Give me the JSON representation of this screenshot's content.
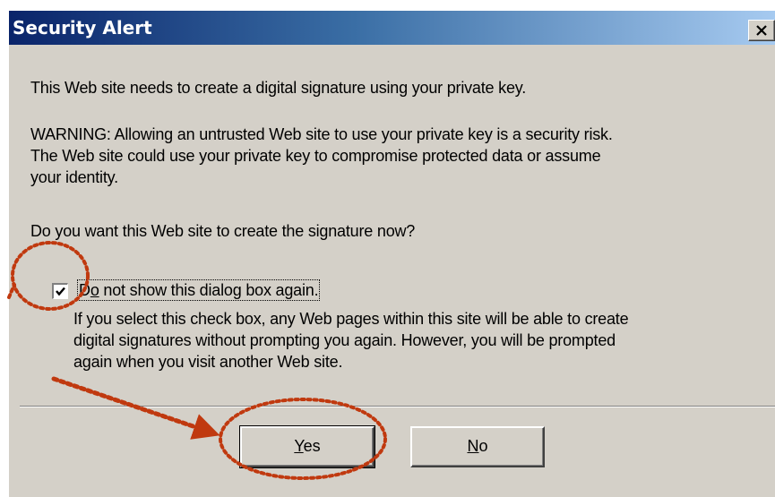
{
  "window": {
    "title": "Security Alert",
    "close_glyph": "✕"
  },
  "body": {
    "intro": "This Web site needs to create a digital signature using your private key.",
    "warning_lines": [
      "WARNING: Allowing an untrusted Web site to use your private key is a security risk.",
      "The Web site could use your private key to compromise protected data or assume",
      "your identity."
    ],
    "question": "Do you want this Web site to create the signature now?"
  },
  "checkbox": {
    "checked": true,
    "label_prefix": "D",
    "label_underlined": "o",
    "label_rest": " not show this dialog box again.",
    "help_lines": [
      "If you select this check box, any Web pages within this site will be able to create",
      "digital signatures without prompting you again. However, you will be prompted",
      "again when you visit another Web site."
    ]
  },
  "buttons": {
    "yes_mnemonic": "Y",
    "yes_rest": "es",
    "no_mnemonic": "N",
    "no_rest": "o"
  },
  "colors": {
    "annotation": "#c0390f",
    "title_gradient_start": "#0a246a",
    "dialog_face": "#d4d0c8"
  }
}
